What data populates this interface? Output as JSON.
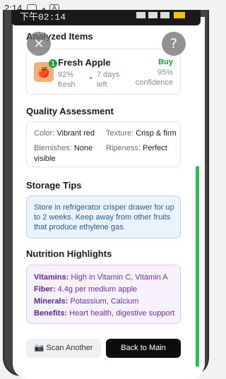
{
  "status_bar": {
    "time": "2:14",
    "icons": [
      "sim-icon",
      "notification-icon"
    ],
    "right_icons": "▼◢▮"
  },
  "inner_status": {
    "time": "下午02:14"
  },
  "header": {
    "close_icon": "×",
    "help_icon": "?"
  },
  "analyzed": {
    "title": "Analyzed Items",
    "item": {
      "emoji": "🍎",
      "badge": "1",
      "name": "Fresh Apple",
      "freshness_pct": "92%",
      "freshness_label": "fresh",
      "days": "7 days",
      "days_label": "left",
      "action": "Buy",
      "confidence_pct": "95%",
      "confidence_label": "confidence"
    }
  },
  "quality": {
    "title": "Quality Assessment",
    "color_label": "Color:",
    "color_value": "Vibrant red",
    "texture_label": "Texture:",
    "texture_value": "Crisp & firm",
    "blemishes_label": "Blemishes:",
    "blemishes_value": "None visible",
    "ripeness_label": "Ripeness:",
    "ripeness_value": "Perfect"
  },
  "storage": {
    "title": "Storage Tips",
    "text": "Store in refrigerator crisper drawer for up to 2 weeks. Keep away from other fruits that produce ethylene gas."
  },
  "nutrition": {
    "title": "Nutrition Highlights",
    "vitamins_label": "Vitamins:",
    "vitamins_value": "High in Vitamin C, Vitamin A",
    "fiber_label": "Fiber:",
    "fiber_value": "4.4g per medium apple",
    "minerals_label": "Minerals:",
    "minerals_value": "Potassium, Calcium",
    "benefits_label": "Benefits:",
    "benefits_value": "Heart health, digestive support"
  },
  "actions": {
    "scan_icon": "📷",
    "scan_label": "Scan Another",
    "back_label": "Back to Main"
  },
  "colors": {
    "accent_green": "#1a9e3a",
    "primary_button": "#0d0d0d",
    "tips_bg": "#eaf3fc",
    "nutrition_bg": "#f7f1fb",
    "scrollbar": "#2bbf55"
  }
}
